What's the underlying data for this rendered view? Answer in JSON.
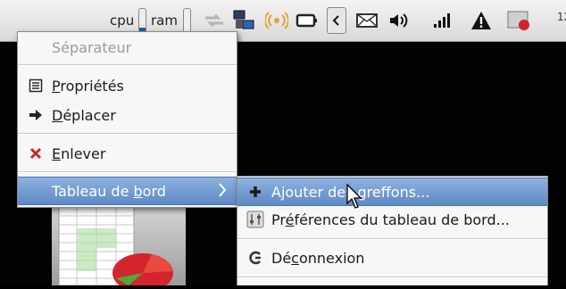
{
  "panel": {
    "cpu_label": "cpu",
    "ram_label": "ram",
    "cpu_level": 0.18,
    "ram_level": 0.05,
    "clock": "12",
    "icons": [
      "network-activity-icon",
      "monitors-icon",
      "wireless-icon",
      "battery-icon",
      "collapse-left-icon",
      "mail-icon",
      "volume-icon",
      "signal-icon",
      "warning-icon",
      "record-icon"
    ]
  },
  "context_menu": {
    "items": [
      {
        "label": "Séparateur",
        "enabled": false
      },
      {
        "pre": "",
        "key": "P",
        "post": "ropriétés",
        "icon": "properties-icon"
      },
      {
        "pre": "",
        "key": "D",
        "post": "éplacer",
        "icon": "move-arrow-icon"
      },
      {
        "pre": "",
        "key": "E",
        "post": "nlever",
        "icon": "remove-x-icon"
      },
      {
        "pre": "Tableau de ",
        "key": "b",
        "post": "ord",
        "icon": "",
        "submenu": true,
        "highlighted": true
      }
    ]
  },
  "submenu": {
    "items": [
      {
        "pre": "Ajouter des greffons...",
        "key": "",
        "post": "",
        "icon": "add-plus-icon",
        "highlighted": true
      },
      {
        "pre": "Pr",
        "key": "é",
        "post": "férences du tableau de bord...",
        "icon": "preferences-icon"
      },
      {
        "pre": "Dé",
        "key": "c",
        "post": "onnexion",
        "icon": "logout-icon"
      }
    ]
  },
  "colors": {
    "highlight": "#6a93cc",
    "menu_bg": "#f7f7f7",
    "remove": "#c0282b",
    "accent_blue": "#1b5fa8"
  }
}
